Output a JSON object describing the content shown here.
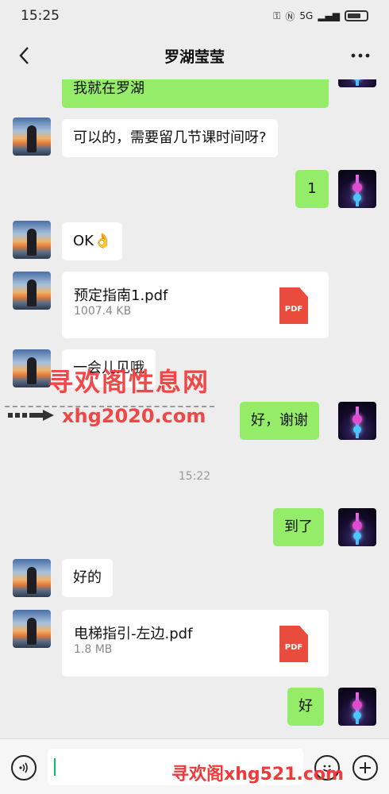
{
  "status": {
    "time": "15:25",
    "network": "5G"
  },
  "header": {
    "title": "罗湖莹莹",
    "back_icon": "chevron-left-icon",
    "more_icon": "more-dots-icon"
  },
  "messages": [
    {
      "side": "right",
      "type": "text",
      "text": "我就在罗湖"
    },
    {
      "side": "left",
      "type": "text",
      "text": "可以的，需要留几节课时间呀?"
    },
    {
      "side": "right",
      "type": "text",
      "text": "1"
    },
    {
      "side": "left",
      "type": "text",
      "text": "OK👌"
    },
    {
      "side": "left",
      "type": "file",
      "name": "预定指南1.pdf",
      "size": "1007.4 KB",
      "icon_label": "PDF"
    },
    {
      "side": "left",
      "type": "text",
      "text": "一会儿见哦"
    },
    {
      "side": "right",
      "type": "text",
      "text": "好，谢谢"
    },
    {
      "type": "timestamp",
      "text": "15:22"
    },
    {
      "side": "right",
      "type": "text",
      "text": "到了"
    },
    {
      "side": "left",
      "type": "text",
      "text": "好的"
    },
    {
      "side": "left",
      "type": "file",
      "name": "电梯指引-左边.pdf",
      "size": "1.8 MB",
      "icon_label": "PDF"
    },
    {
      "side": "right",
      "type": "text",
      "text": "好"
    }
  ],
  "watermarks": {
    "line1": "寻欢阁性息网",
    "line2": "xhg2020.com",
    "line3": "寻欢阁xhg521.com"
  },
  "input": {
    "voice_icon": "voice-icon",
    "emoji_icon": "emoji-icon",
    "plus_icon": "plus-icon",
    "value": ""
  },
  "colors": {
    "sent_bubble": "#95ec69",
    "received_bubble": "#ffffff",
    "background": "#ededed",
    "watermark": "#f03a3a",
    "pdf": "#e94b3c"
  }
}
